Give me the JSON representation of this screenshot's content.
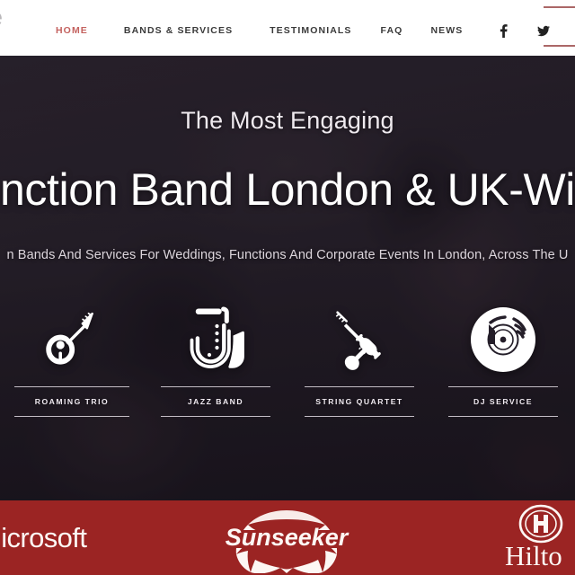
{
  "header": {
    "logo_text": "late",
    "nav_items": [
      {
        "label": "HOME",
        "active": true
      },
      {
        "label": "BANDS & SERVICES",
        "active": false
      },
      {
        "label": "TESTIMONIALS",
        "active": false
      },
      {
        "label": "FAQ",
        "active": false
      },
      {
        "label": "NEWS",
        "active": false
      }
    ],
    "social": [
      {
        "name": "facebook-icon",
        "label": "f"
      },
      {
        "name": "twitter-icon",
        "label": "twitter"
      }
    ],
    "accent_color": "#c4625f",
    "nav_text_color": "#3a3a3a",
    "background_color": "#ffffff",
    "rule_color": "#9c4c4c"
  },
  "hero": {
    "eyebrow": "The Most Engaging",
    "headline": "nction Band London & UK-Wi",
    "subheadline": "n Bands And Services For Weddings, Functions And Corporate Events In London, Across The U",
    "background_color": "#241e29",
    "text_color": "#ffffff",
    "tiles": [
      {
        "icon": "guitar-icon",
        "label": "ROAMING TRIO"
      },
      {
        "icon": "saxophone-icon",
        "label": "JAZZ BAND"
      },
      {
        "icon": "violin-icon",
        "label": "STRING QUARTET"
      },
      {
        "icon": "vinyl-record-icon",
        "label": "DJ SERVICE"
      }
    ]
  },
  "clients": {
    "background_color": "#9b2423",
    "logo_color": "#fdf7f4",
    "items": [
      {
        "name": "microsoft-logo",
        "label": "Microsoft"
      },
      {
        "name": "sunseeker-logo",
        "label": "Sunseeker"
      },
      {
        "name": "hilton-logo",
        "label": "Hilto"
      }
    ]
  }
}
